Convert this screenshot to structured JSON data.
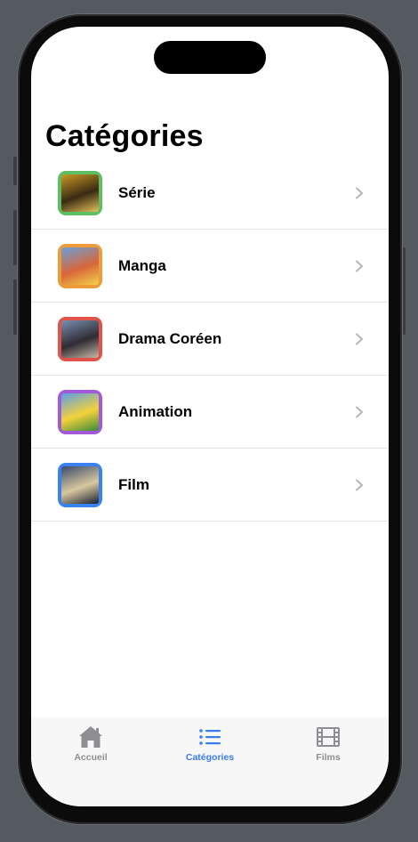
{
  "page": {
    "title": "Catégories"
  },
  "categories": [
    {
      "label": "Série",
      "frame_color": "#5cc062",
      "art": [
        "#c99a27",
        "#3a2a12",
        "#e2c15a"
      ]
    },
    {
      "label": "Manga",
      "frame_color": "#ee9b3a",
      "art": [
        "#6aa0d8",
        "#d9663a",
        "#f2d24a"
      ]
    },
    {
      "label": "Drama Coréen",
      "frame_color": "#e0524a",
      "art": [
        "#7a8fb0",
        "#2f2c33",
        "#c8b7a6"
      ]
    },
    {
      "label": "Animation",
      "frame_color": "#a15ad8",
      "art": [
        "#5aa0e6",
        "#f4d23a",
        "#3a8a3a"
      ]
    },
    {
      "label": "Film",
      "frame_color": "#3b82f1",
      "art": [
        "#3a4a6a",
        "#d8c8a0",
        "#1a1f2e"
      ]
    }
  ],
  "tabbar": {
    "tabs": [
      {
        "label": "Accueil",
        "icon": "house-icon",
        "active": false
      },
      {
        "label": "Catégories",
        "icon": "list-icon",
        "active": true
      },
      {
        "label": "Films",
        "icon": "film-icon",
        "active": false
      }
    ],
    "active_color": "#3a7cf0",
    "inactive_color": "#8e8e93"
  }
}
